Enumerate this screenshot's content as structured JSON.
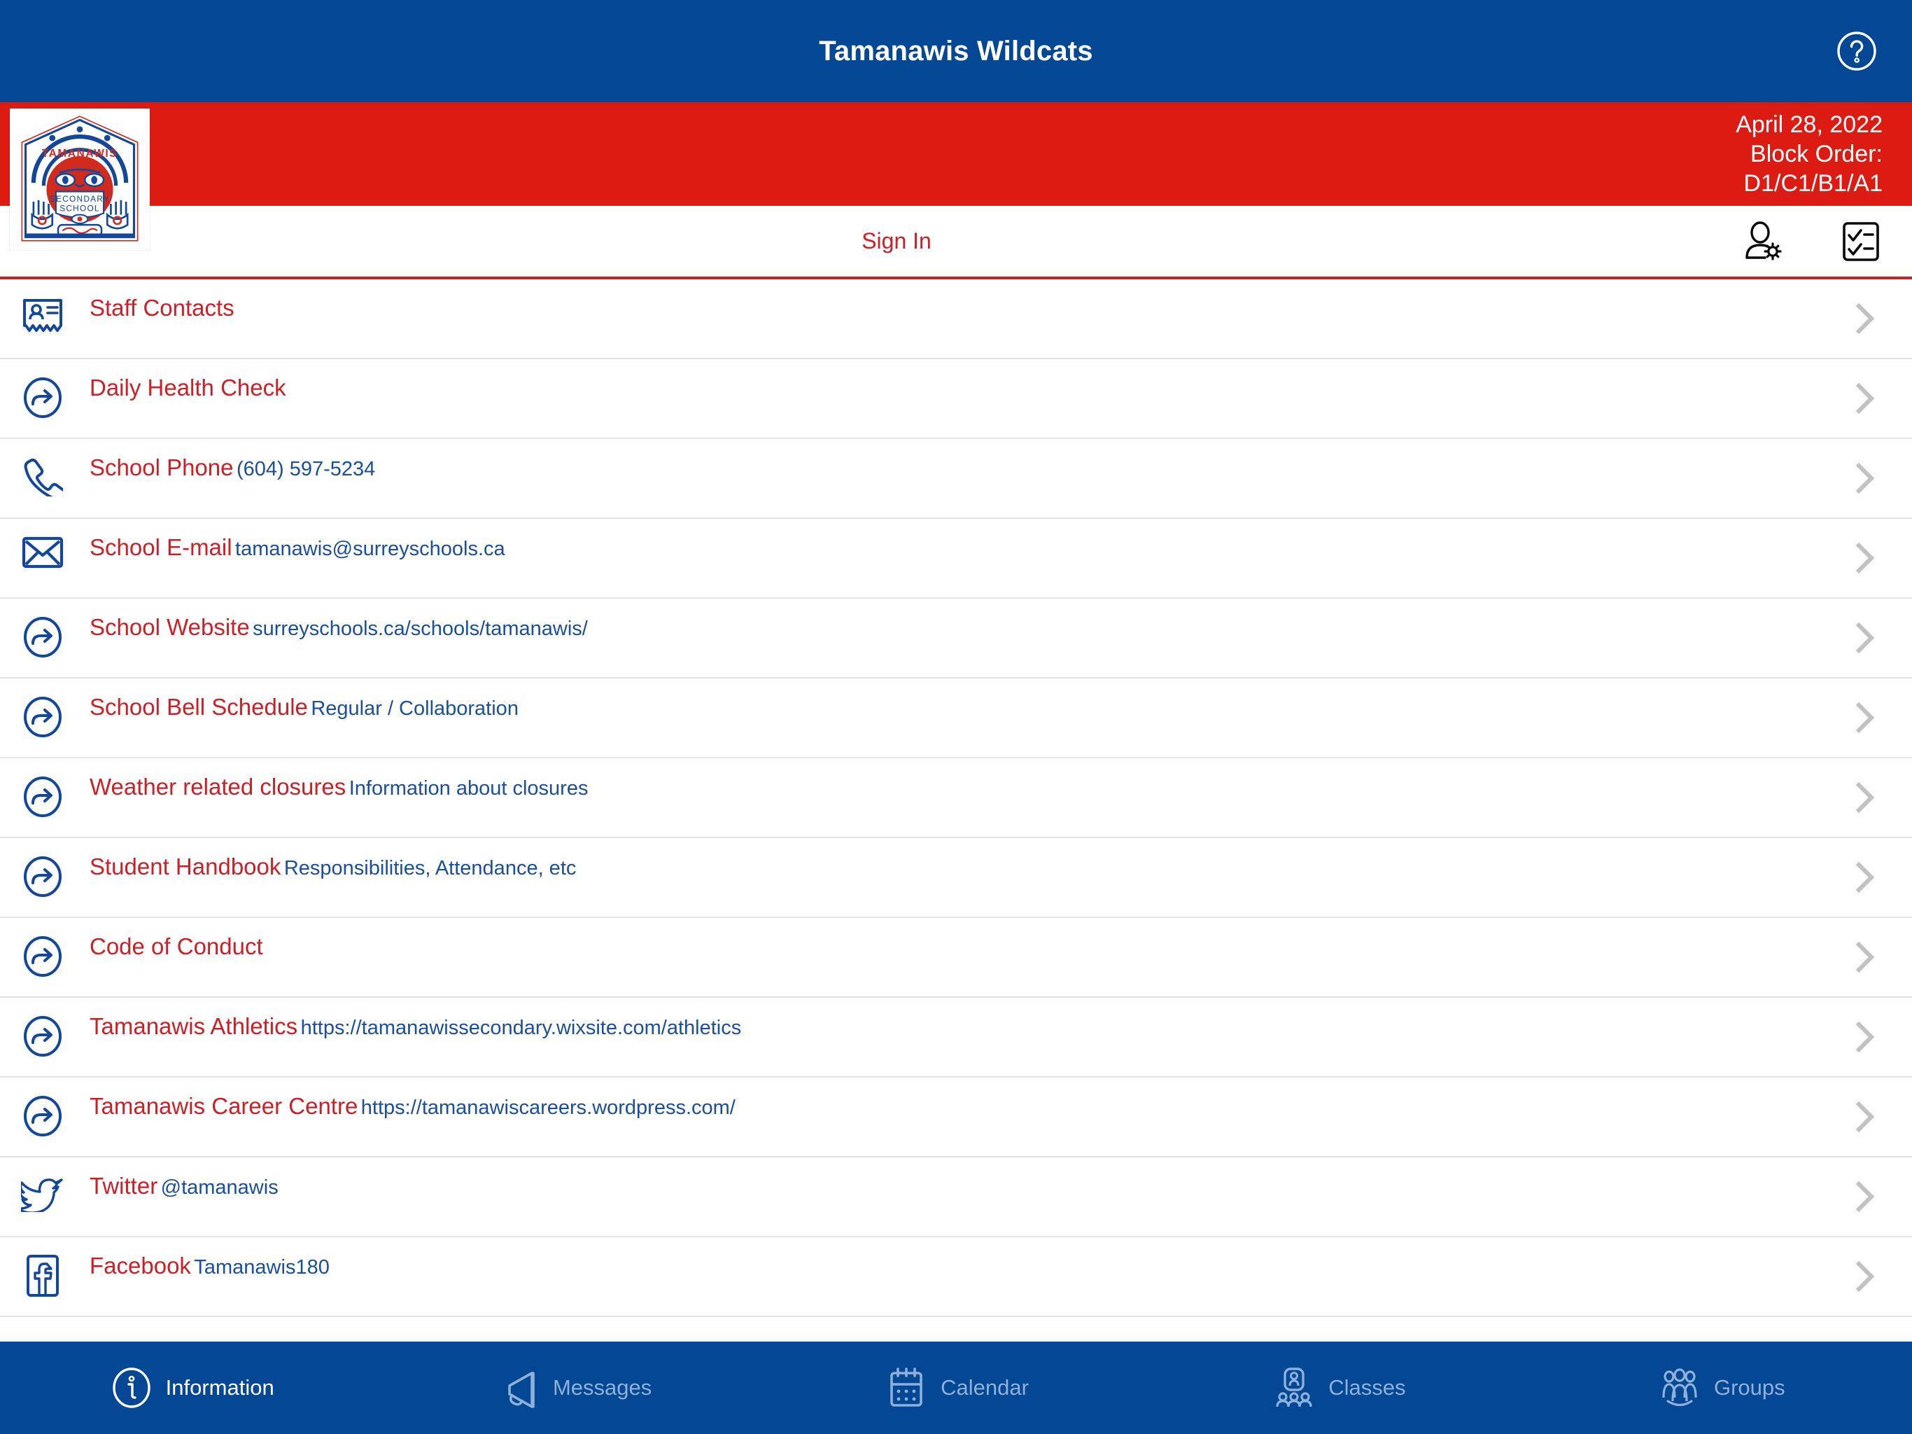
{
  "titlebar": {
    "title": "Tamanawis Wildcats",
    "help_icon": "help-circle-icon"
  },
  "banner": {
    "logo_alt": "Tamanawis Secondary School",
    "logo_text_top": "TAMANAWIS",
    "logo_text_mid": "SECONDARY",
    "logo_text_bot": "SCHOOL",
    "date": "April 28, 2022",
    "block_order_label": "Block Order:",
    "block_order_value": "D1/C1/B1/A1"
  },
  "toolbar": {
    "sign_in_label": "Sign In",
    "user_settings_icon": "user-settings-icon",
    "checklist_icon": "checklist-icon"
  },
  "list": {
    "items": [
      {
        "icon": "contact-card-icon",
        "title": "Staff Contacts",
        "subtitle": ""
      },
      {
        "icon": "external-link-icon",
        "title": "Daily Health Check",
        "subtitle": ""
      },
      {
        "icon": "phone-icon",
        "title": "School Phone",
        "subtitle": "(604) 597-5234"
      },
      {
        "icon": "envelope-icon",
        "title": "School E-mail",
        "subtitle": "tamanawis@surreyschools.ca"
      },
      {
        "icon": "external-link-icon",
        "title": "School Website",
        "subtitle": "surreyschools.ca/schools/tamanawis/"
      },
      {
        "icon": "external-link-icon",
        "title": "School Bell Schedule",
        "subtitle": "Regular / Collaboration"
      },
      {
        "icon": "external-link-icon",
        "title": "Weather related closures",
        "subtitle": "Information about closures"
      },
      {
        "icon": "external-link-icon",
        "title": "Student Handbook",
        "subtitle": "Responsibilities, Attendance, etc"
      },
      {
        "icon": "external-link-icon",
        "title": "Code of Conduct",
        "subtitle": ""
      },
      {
        "icon": "external-link-icon",
        "title": "Tamanawis Athletics",
        "subtitle": "https://tamanawissecondary.wixsite.com/athletics"
      },
      {
        "icon": "external-link-icon",
        "title": "Tamanawis Career Centre",
        "subtitle": "https://tamanawiscareers.wordpress.com/"
      },
      {
        "icon": "twitter-icon",
        "title": "Twitter",
        "subtitle": "@tamanawis"
      },
      {
        "icon": "facebook-icon",
        "title": "Facebook",
        "subtitle": "Tamanawis180"
      }
    ],
    "chevron_icon": "chevron-right-icon"
  },
  "tabbar": {
    "tabs": [
      {
        "label": "Information",
        "icon": "info-circle-icon",
        "active": true
      },
      {
        "label": "Messages",
        "icon": "megaphone-icon",
        "active": false
      },
      {
        "label": "Calendar",
        "icon": "calendar-icon",
        "active": false
      },
      {
        "label": "Classes",
        "icon": "classes-icon",
        "active": false
      },
      {
        "label": "Groups",
        "icon": "groups-icon",
        "active": false
      }
    ]
  },
  "colors": {
    "brand_blue": "#044794",
    "brand_red": "#dc1c13",
    "title_red": "#cc2026",
    "subtitle_blue": "#1a4f9c",
    "tab_inactive": "#8fb0d8",
    "divider": "#e3e3e3"
  }
}
